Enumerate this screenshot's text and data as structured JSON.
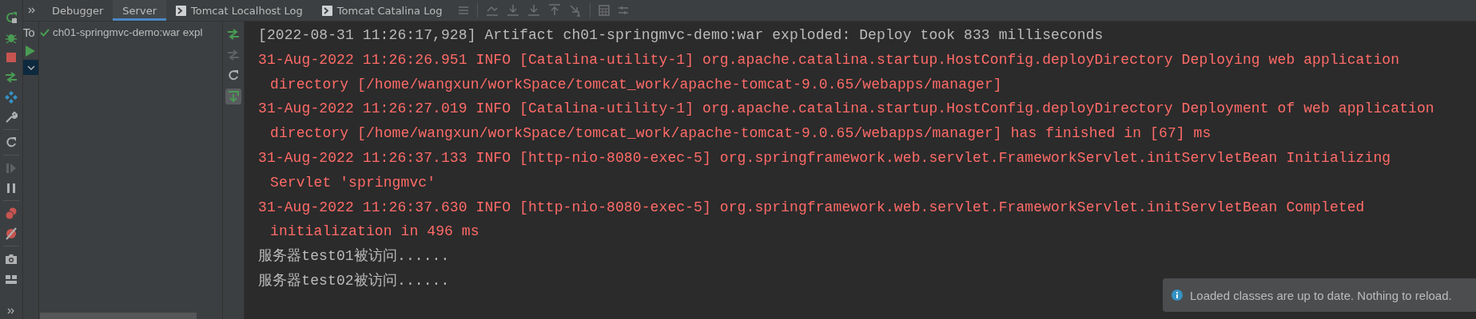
{
  "tabs": [
    {
      "label": "Debugger",
      "selected": false,
      "kind": "plain"
    },
    {
      "label": "Server",
      "selected": true,
      "kind": "plain"
    },
    {
      "label": "Tomcat Localhost Log",
      "selected": false,
      "kind": "log"
    },
    {
      "label": "Tomcat Catalina Log",
      "selected": false,
      "kind": "log"
    }
  ],
  "services_tab": "To",
  "tree": [
    {
      "label": "ch01-springmvc-demo:war expl",
      "deployed": true
    }
  ],
  "console": [
    {
      "kind": "info",
      "lines": [
        "[2022-08-31 11:26:17,928] Artifact ch01-springmvc-demo:war exploded: Deploy took 833 milliseconds"
      ]
    },
    {
      "kind": "error",
      "lines": [
        "31-Aug-2022 11:26:26.951 INFO [Catalina-utility-1] org.apache.catalina.startup.HostConfig.deployDirectory Deploying web application",
        "directory [/home/wangxun/workSpace/tomcat_work/apache-tomcat-9.0.65/webapps/manager]"
      ]
    },
    {
      "kind": "error",
      "lines": [
        "31-Aug-2022 11:26:27.019 INFO [Catalina-utility-1] org.apache.catalina.startup.HostConfig.deployDirectory Deployment of web application",
        "directory [/home/wangxun/workSpace/tomcat_work/apache-tomcat-9.0.65/webapps/manager] has finished in [67] ms"
      ]
    },
    {
      "kind": "error",
      "lines": [
        "31-Aug-2022 11:26:37.133 INFO [http-nio-8080-exec-5] org.springframework.web.servlet.FrameworkServlet.initServletBean Initializing",
        "Servlet 'springmvc'"
      ]
    },
    {
      "kind": "error",
      "lines": [
        "31-Aug-2022 11:26:37.630 INFO [http-nio-8080-exec-5] org.springframework.web.servlet.FrameworkServlet.initServletBean Completed",
        "initialization in 496 ms"
      ]
    },
    {
      "kind": "info",
      "lines": [
        "服务器test01被访问......"
      ]
    },
    {
      "kind": "info",
      "lines": [
        "服务器test02被访问......"
      ]
    }
  ],
  "notification": {
    "kind": "info",
    "text": "Loaded classes are up to date. Nothing to reload."
  }
}
